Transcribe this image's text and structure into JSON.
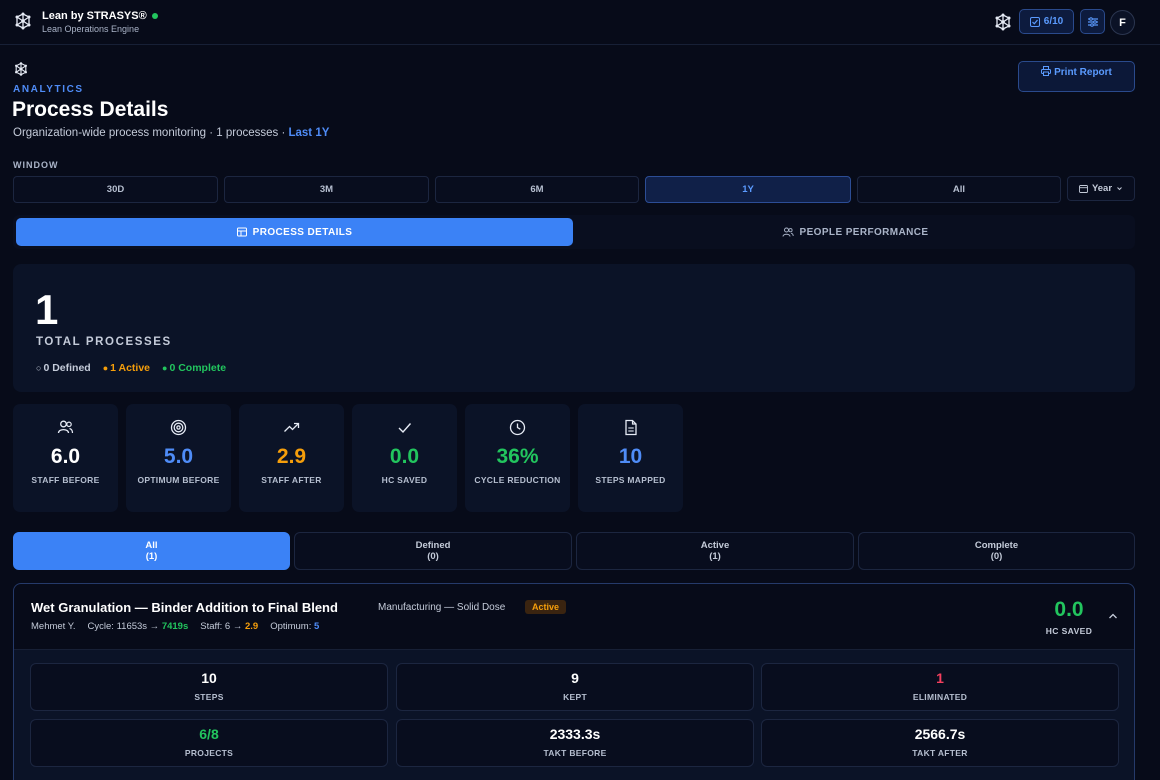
{
  "app": {
    "brand_name": "Lean by STRASYS®",
    "brand_sub": "Lean Operations Engine",
    "progress": "6/10",
    "avatar_initial": "F"
  },
  "header": {
    "eyebrow": "ANALYTICS",
    "title": "Process Details",
    "subtitle_prefix": "Organization-wide process monitoring · 1 processes · ",
    "subtitle_range": "Last 1Y",
    "print_label": "Print Report"
  },
  "window": {
    "label": "WINDOW",
    "options": [
      "30D",
      "3M",
      "6M",
      "1Y",
      "All"
    ],
    "selected": "1Y",
    "year_select": "Year"
  },
  "tabs": {
    "process_details": "PROCESS DETAILS",
    "people_performance": "PEOPLE PERFORMANCE"
  },
  "summary": {
    "total": "1",
    "total_label": "TOTAL PROCESSES",
    "defined": "0 Defined",
    "active": "1 Active",
    "complete": "0 Complete"
  },
  "metrics": [
    {
      "value": "6.0",
      "label": "STAFF BEFORE",
      "icon": "users-icon",
      "color": "#ffffff"
    },
    {
      "value": "5.0",
      "label": "OPTIMUM BEFORE",
      "icon": "target-icon",
      "color": "#4f8cf7"
    },
    {
      "value": "2.9",
      "label": "STAFF AFTER",
      "icon": "trend-up-icon",
      "color": "#f59e0b"
    },
    {
      "value": "0.0",
      "label": "HC SAVED",
      "icon": "check-icon",
      "color": "#22c55e"
    },
    {
      "value": "36%",
      "label": "CYCLE REDUCTION",
      "icon": "clock-icon",
      "color": "#22c55e"
    },
    {
      "value": "10",
      "label": "STEPS MAPPED",
      "icon": "document-icon",
      "color": "#4f8cf7"
    }
  ],
  "filters": [
    {
      "label": "All",
      "count": "(1)"
    },
    {
      "label": "Defined",
      "count": "(0)"
    },
    {
      "label": "Active",
      "count": "(1)"
    },
    {
      "label": "Complete",
      "count": "(0)"
    }
  ],
  "process": {
    "title": "Wet Granulation — Binder Addition to Final Blend",
    "category": "Manufacturing — Solid Dose",
    "status": "Active",
    "owner": "Mehmet Y.",
    "cycle_label": "Cycle: 11653s → ",
    "cycle_after": "7419s",
    "staff_label": "Staff: 6 → ",
    "staff_after": "2.9",
    "optimum_label": "Optimum: ",
    "optimum_value": "5",
    "hc_saved_value": "0.0",
    "hc_saved_label": "HC SAVED",
    "stats": [
      {
        "value": "10",
        "label": "STEPS",
        "color": "#ffffff"
      },
      {
        "value": "9",
        "label": "KEPT",
        "color": "#ffffff"
      },
      {
        "value": "1",
        "label": "ELIMINATED",
        "color": "#f43f5e"
      },
      {
        "value": "6/8",
        "label": "PROJECTS",
        "color": "#22c55e"
      },
      {
        "value": "2333.3s",
        "label": "TAKT BEFORE",
        "color": "#ffffff"
      },
      {
        "value": "2566.7s",
        "label": "TAKT AFTER",
        "color": "#ffffff"
      }
    ]
  }
}
